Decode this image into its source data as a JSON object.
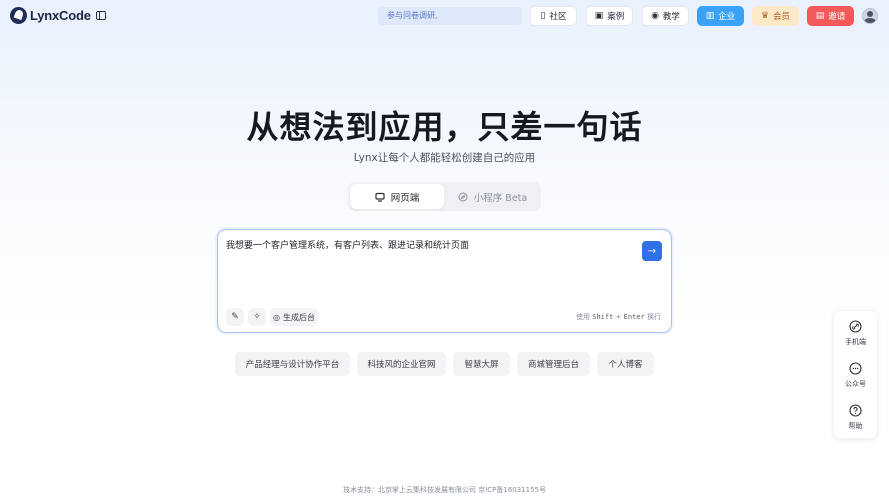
{
  "header": {
    "logo_text": "LynxCode",
    "notice": "参与问卷调研,",
    "nav": [
      {
        "label": "社区",
        "icon": "document-icon"
      },
      {
        "label": "案例",
        "icon": "bookmark-icon"
      },
      {
        "label": "教学",
        "icon": "play-circle-icon"
      }
    ],
    "enterprise_label": "企业",
    "member_label": "会员",
    "invite_label": "邀请"
  },
  "hero": {
    "title": "从想法到应用，只差一句话",
    "subtitle": "Lynx让每个人都能轻松创建自己的应用"
  },
  "mode": {
    "tabs": [
      {
        "label": "网页端",
        "icon": "monitor-icon",
        "active": true
      },
      {
        "label": "小程序 Beta",
        "icon": "compass-icon",
        "active": false
      }
    ]
  },
  "prompt": {
    "text": "我想要一个客户管理系统，有客户列表、跟进记录和统计页面",
    "generate_backend_label": "生成后台",
    "hint_use": "使用",
    "hint_shift": "Shift",
    "hint_plus": "+",
    "hint_enter": "Enter",
    "hint_newline": "换行"
  },
  "suggestions": [
    "产品经理与设计协作平台",
    "科技风的企业官网",
    "智慧大屏",
    "商城管理后台",
    "个人博客"
  ],
  "float_panel": [
    {
      "label": "手机端",
      "icon": "link-icon"
    },
    {
      "label": "公众号",
      "icon": "chat-icon"
    },
    {
      "label": "帮助",
      "icon": "help-icon"
    }
  ],
  "footer": {
    "text": "技术支持：北京掌上云集科技发展有限公司   京ICP备16031155号"
  },
  "colors": {
    "accent": "#2f6fe8",
    "enterprise": "#3ba3f7",
    "member_bg": "#fde8c8",
    "invite": "#f25a5a"
  }
}
